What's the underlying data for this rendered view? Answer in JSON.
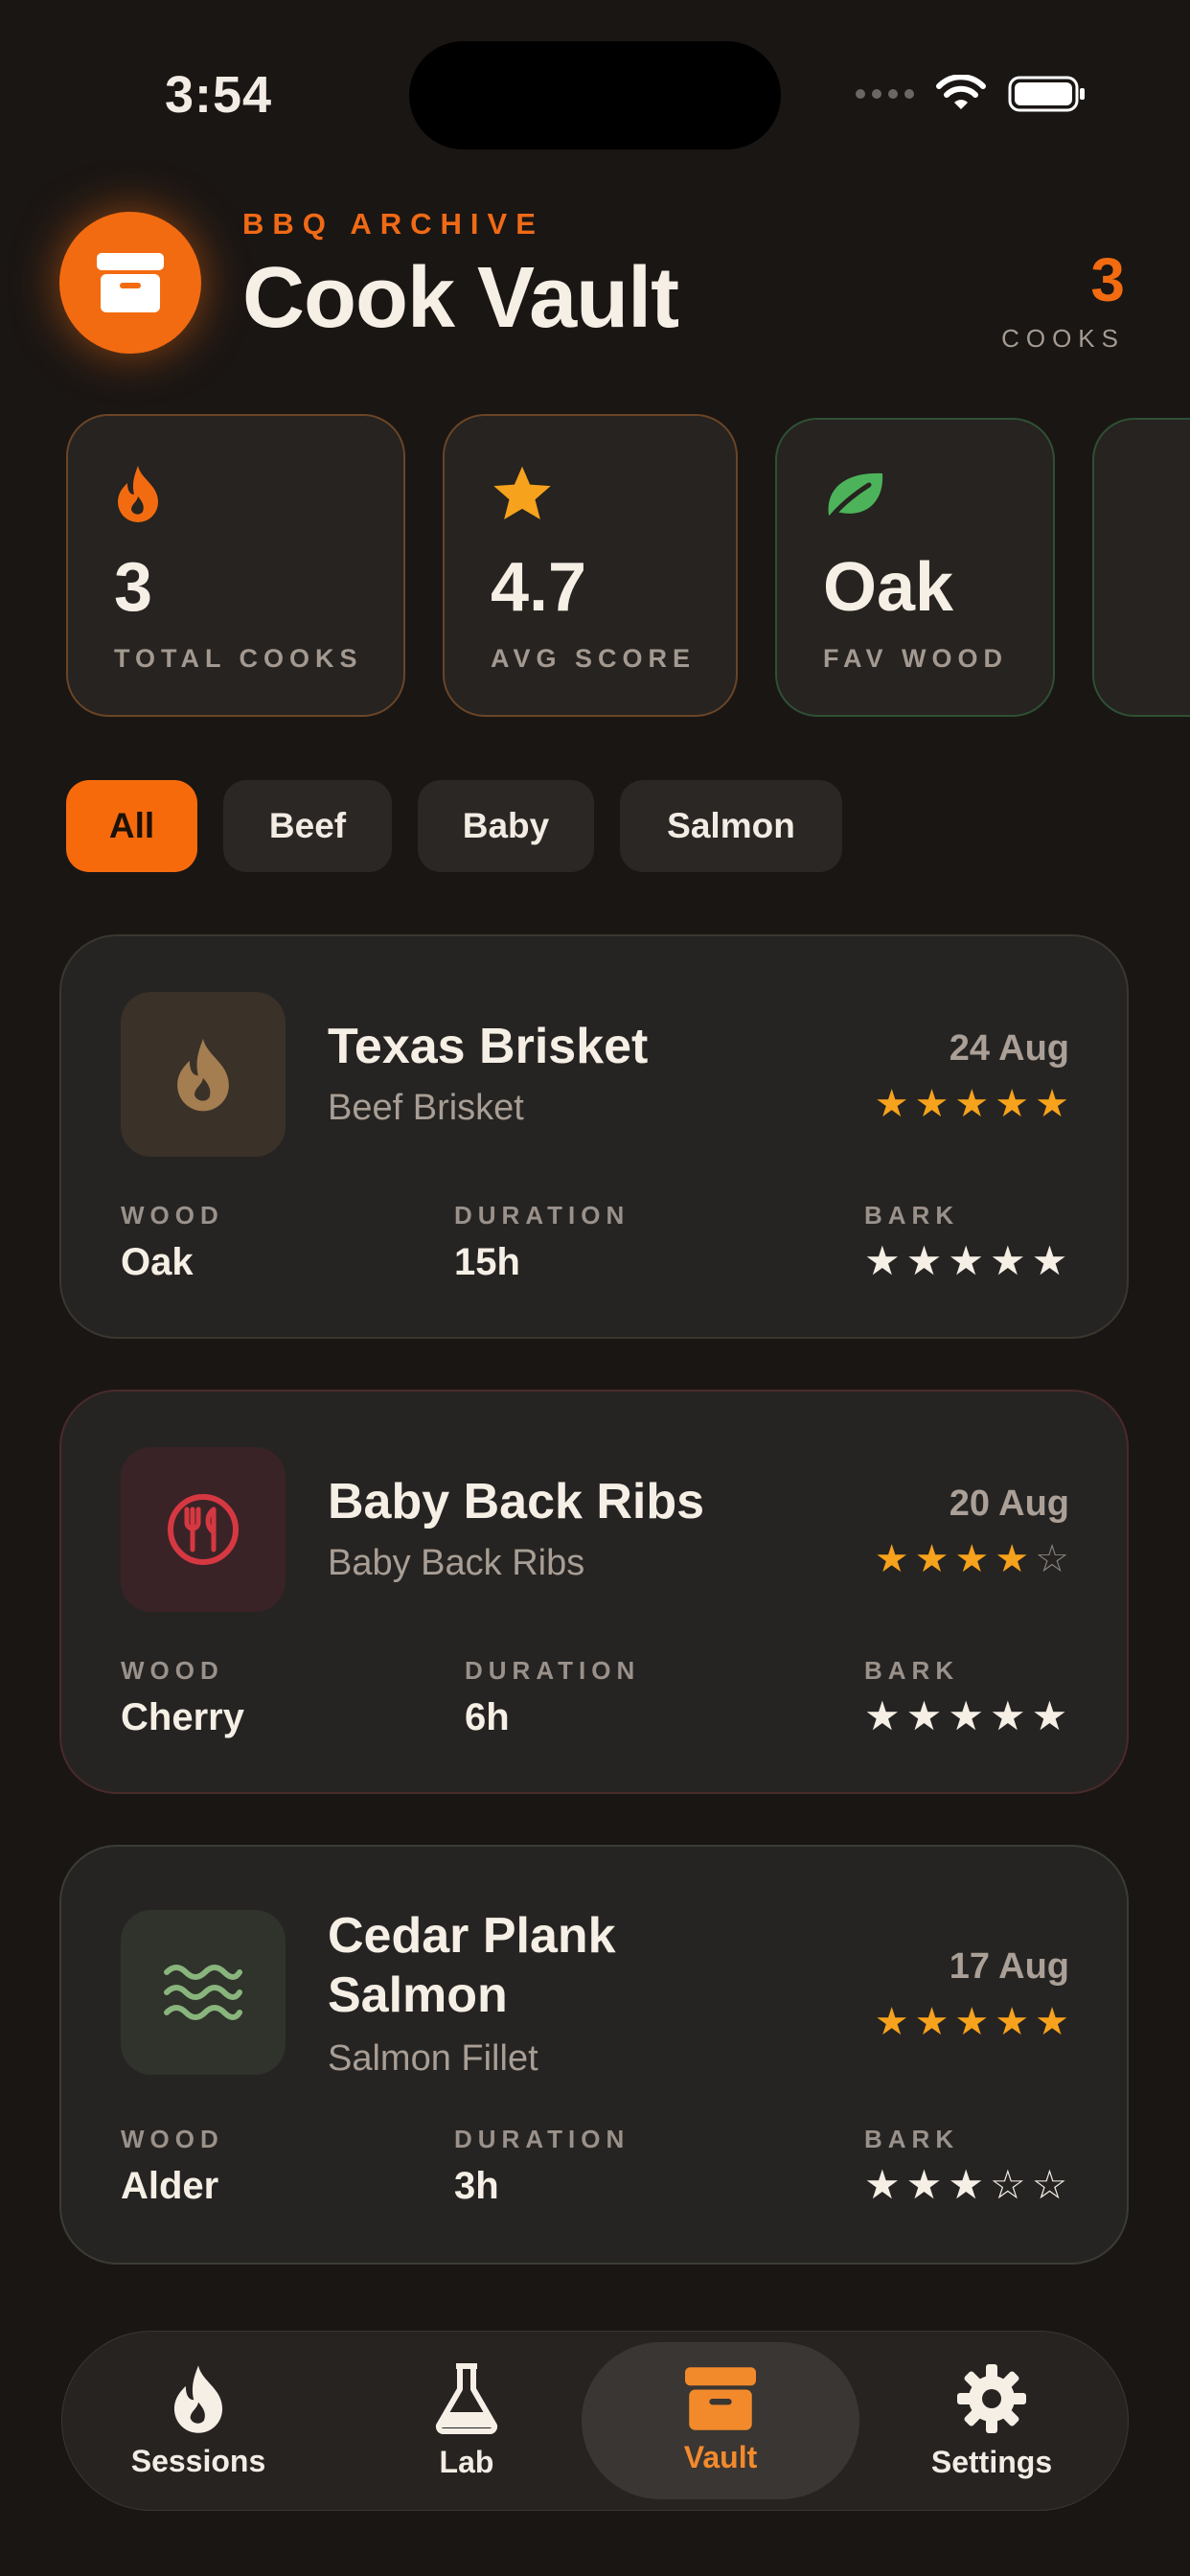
{
  "status": {
    "time": "3:54"
  },
  "header": {
    "eyebrow": "BBQ ARCHIVE",
    "title": "Cook Vault",
    "count": "3",
    "count_label": "COOKS"
  },
  "stats": [
    {
      "value": "3",
      "label": "TOTAL COOKS",
      "icon": "flame-icon"
    },
    {
      "value": "4.7",
      "label": "AVG SCORE",
      "icon": "star-icon"
    },
    {
      "value": "Oak",
      "label": "FAV WOOD",
      "icon": "leaf-icon"
    }
  ],
  "filters": [
    {
      "label": "All",
      "active": true
    },
    {
      "label": "Beef",
      "active": false
    },
    {
      "label": "Baby",
      "active": false
    },
    {
      "label": "Salmon",
      "active": false
    }
  ],
  "labels": {
    "wood": "WOOD",
    "duration": "DURATION",
    "bark": "BARK"
  },
  "cooks": [
    {
      "name": "Texas Brisket",
      "cut": "Beef Brisket",
      "date": "24 Aug",
      "rating": 5,
      "wood": "Oak",
      "duration": "15h",
      "bark": 5,
      "icon": "flame-icon"
    },
    {
      "name": "Baby Back Ribs",
      "cut": "Baby Back Ribs",
      "date": "20 Aug",
      "rating": 4,
      "wood": "Cherry",
      "duration": "6h",
      "bark": 5,
      "icon": "fork-knife-icon"
    },
    {
      "name": "Cedar Plank Salmon",
      "cut": "Salmon Fillet",
      "date": "17 Aug",
      "rating": 5,
      "wood": "Alder",
      "duration": "3h",
      "bark": 3,
      "icon": "waves-icon"
    }
  ],
  "tabs": [
    {
      "label": "Sessions",
      "icon": "flame-icon"
    },
    {
      "label": "Lab",
      "icon": "flask-icon"
    },
    {
      "label": "Vault",
      "icon": "archive-icon",
      "active": true
    },
    {
      "label": "Settings",
      "icon": "gear-icon"
    }
  ],
  "colors": {
    "accent": "#f36b10",
    "star": "#f7a21c",
    "background": "#1a1614"
  }
}
